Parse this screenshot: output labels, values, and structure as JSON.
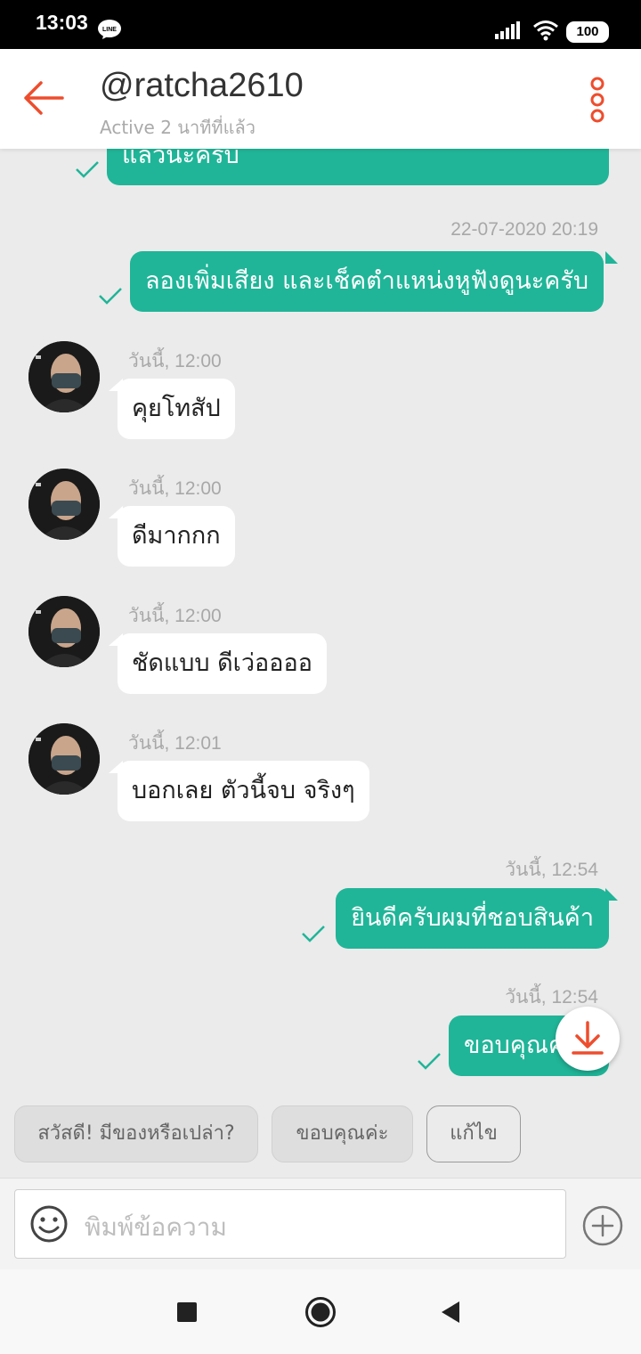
{
  "status_bar": {
    "time": "13:03",
    "battery": "100"
  },
  "header": {
    "title": "@ratcha2610",
    "subtitle": "Active 2 นาทีที่แล้ว"
  },
  "messages": {
    "m0": {
      "text": "แล้วนะครับ"
    },
    "m1": {
      "time": "22-07-2020 20:19",
      "text": "ลองเพิ่มเสียง  และเช็คตำแหน่งหูฟังดูนะครับ"
    },
    "m2": {
      "time": "วันนี้, 12:00",
      "text": "คุยโทสัป"
    },
    "m3": {
      "time": "วันนี้, 12:00",
      "text": "ดีมากกก"
    },
    "m4": {
      "time": "วันนี้, 12:00",
      "text": "ชัดแบบ ดีเว่ออออ"
    },
    "m5": {
      "time": "วันนี้, 12:01",
      "text": "บอกเลย ตัวนี้จบ จริงๆ"
    },
    "m6": {
      "time": "วันนี้, 12:54",
      "text": "ยินดีครับผมที่ชอบสินค้า"
    },
    "m7": {
      "time": "วันนี้, 12:54",
      "text": "ขอบคุณค"
    }
  },
  "quick_replies": [
    "สวัสดี! มีของหรือเปล่า?",
    "ขอบคุณค่ะ",
    "แก้ไข"
  ],
  "input": {
    "placeholder": "พิมพ์ข้อความ"
  },
  "colors": {
    "accent": "#20b598",
    "brand": "#ee4d2d",
    "background": "#ebebeb"
  },
  "icons": [
    "back-arrow-icon",
    "more-vert-icon",
    "check-icon",
    "download-arrow-icon",
    "emoji-icon",
    "plus-icon",
    "line-icon",
    "signal-icon",
    "wifi-icon",
    "battery-icon",
    "nav-recent-icon",
    "nav-home-icon",
    "nav-back-icon"
  ]
}
